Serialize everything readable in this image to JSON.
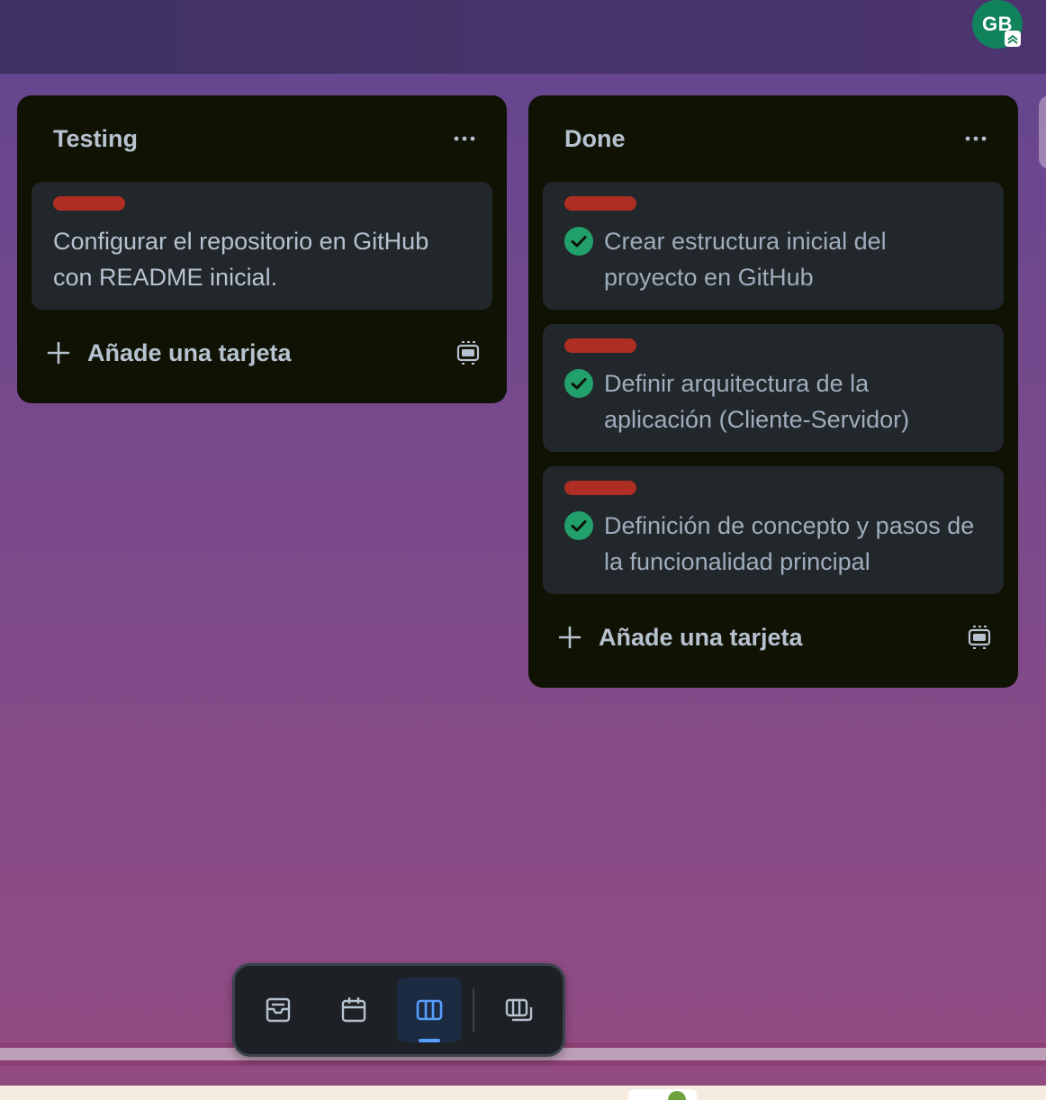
{
  "header": {
    "avatar_initials": "GB",
    "avatar_color": "#11835c"
  },
  "lists": [
    {
      "title": "Testing",
      "cards": [
        {
          "label_color": "#ae2e24",
          "title": "Configurar el repositorio en GitHub con README inicial.",
          "completed": false
        }
      ],
      "add_card_label": "Añade una tarjeta"
    },
    {
      "title": "Done",
      "cards": [
        {
          "label_color": "#ae2e24",
          "title": "Crear estructura inicial del proyecto en GitHub",
          "completed": true
        },
        {
          "label_color": "#ae2e24",
          "title": "Definir arquitectura de la aplicación (Cliente-Servidor)",
          "completed": true
        },
        {
          "label_color": "#ae2e24",
          "title": "Definición de concepto y pasos de la funcionalidad principal",
          "completed": true
        }
      ],
      "add_card_label": "Añade una tarjeta"
    }
  ],
  "view_switcher": {
    "items": [
      {
        "icon": "inbox-icon",
        "active": false
      },
      {
        "icon": "calendar-icon",
        "active": false
      },
      {
        "icon": "board-icon",
        "active": true
      },
      {
        "icon": "switch-boards-icon",
        "active": false
      }
    ],
    "accent_color": "#579dff"
  },
  "colors": {
    "list_bg": "#101204",
    "card_bg": "#22272b",
    "complete_green": "#22a06b"
  }
}
